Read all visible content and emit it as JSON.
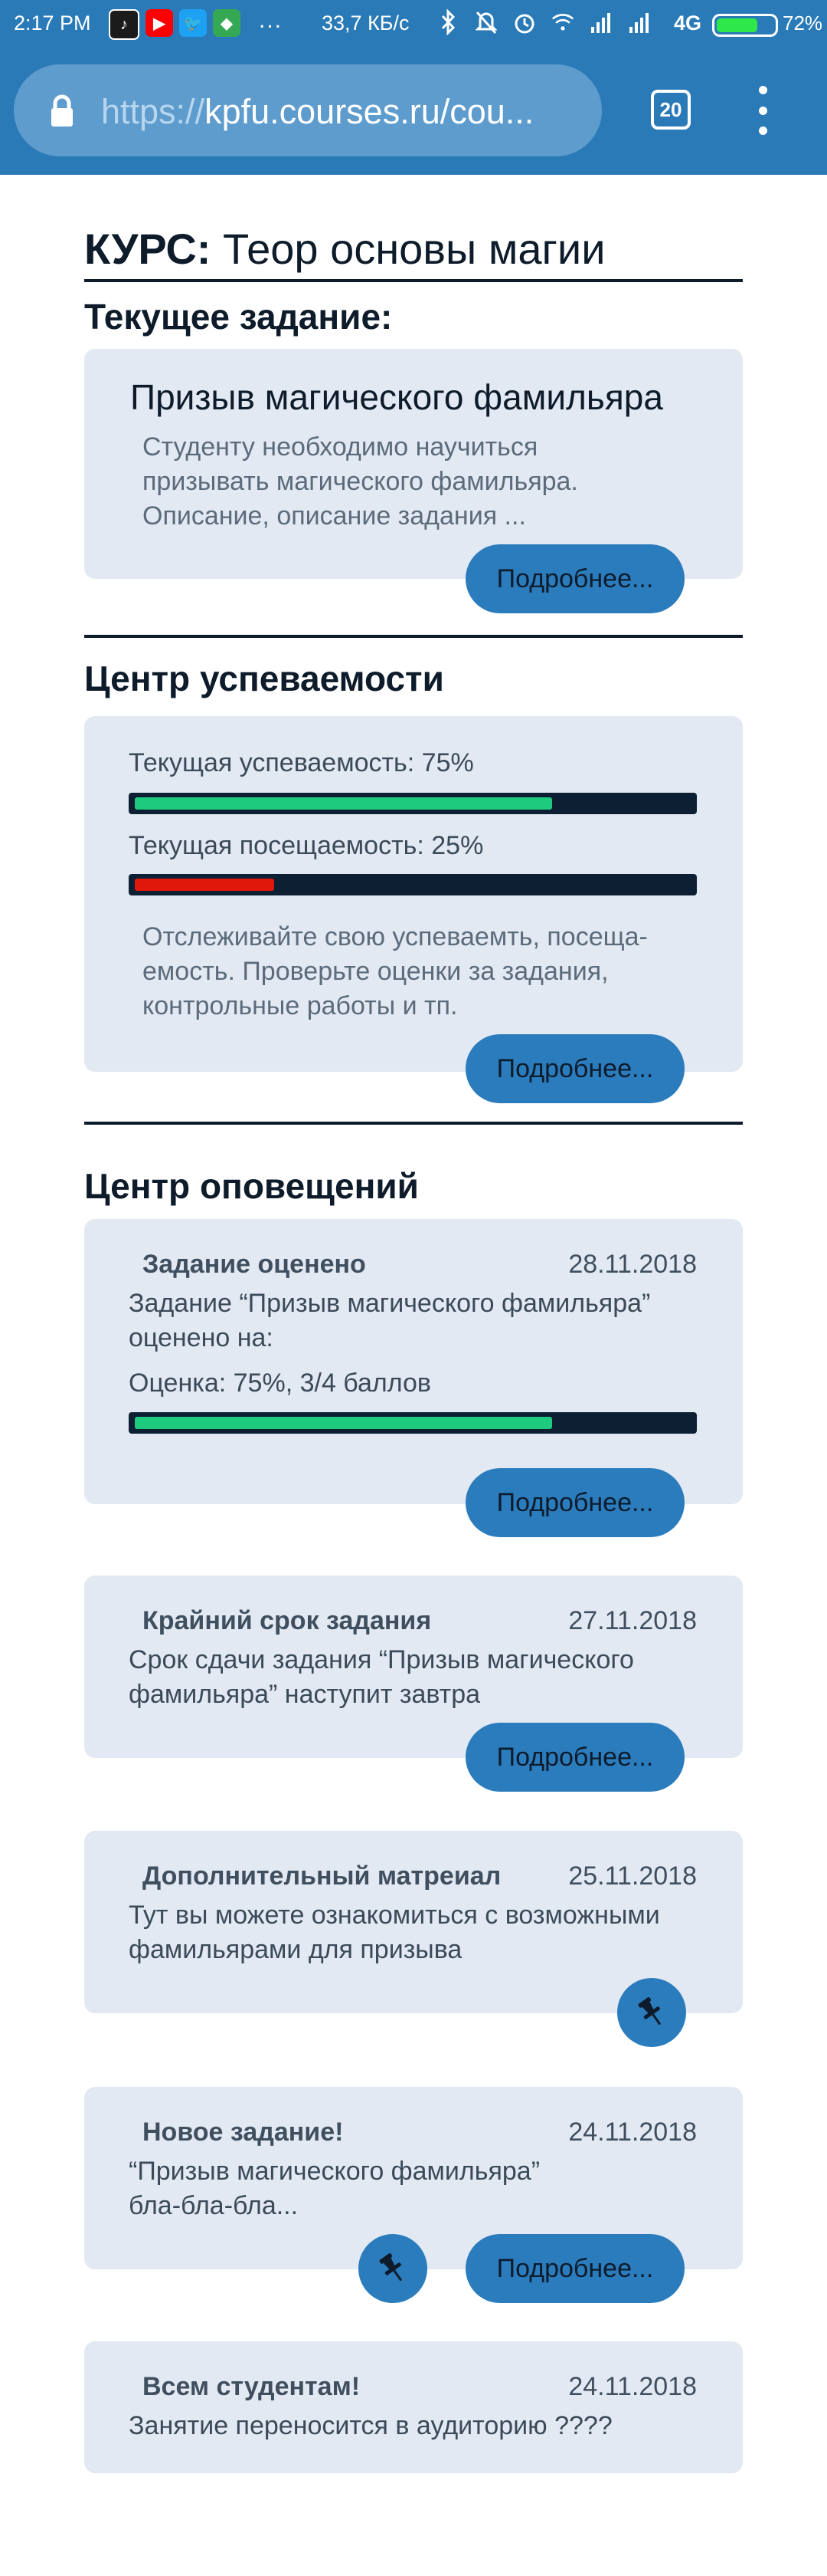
{
  "statusbar": {
    "time": "2:17 PM",
    "dots": "...",
    "speed": "33,7 КБ/с",
    "network": "4G",
    "battery_pct": "72%",
    "battery_level": 0.72
  },
  "browser": {
    "url_proto": "https://",
    "url_rest": "kpfu.courses.ru/cou...",
    "tab_count": "20"
  },
  "course": {
    "prefix": "КУРС:",
    "name": "Теор основы магии"
  },
  "current_task": {
    "heading": "Текущее задание:",
    "title": "Призыв магического фамильяра",
    "description": [
      "Студенту необходимо научиться",
      "призывать магического фамильяра.",
      "Описание, описание задания ..."
    ],
    "more": "Подробнее..."
  },
  "progress": {
    "heading": "Центр успеваемости",
    "grade_label": "Текущая успеваемость: 75%",
    "grade_value": 0.75,
    "attendance_label": "Текущая посещаемость: 25%",
    "attendance_value": 0.25,
    "description": [
      "Отслеживайте свою успеваемть, посеща-",
      "емость. Проверьте оценки за задания,",
      "контрольные работы и тп."
    ],
    "more": "Подробнее..."
  },
  "notifications": {
    "heading": "Центр оповещений",
    "items": [
      {
        "title": "Задание оценено",
        "date": "28.11.2018",
        "lines": [
          "Задание “Призыв магического фамильяра”",
          "оценено на:"
        ],
        "score_label": "Оценка: 75%, 3/4 баллов",
        "score_value": 0.75,
        "more": "Подробнее..."
      },
      {
        "title": "Крайний срок задания",
        "date": "27.11.2018",
        "lines": [
          "Срок сдачи задания “Призыв магического",
          "фамильяра” наступит завтра"
        ],
        "more": "Подробнее..."
      },
      {
        "title": "Дополнительный матреиал",
        "date": "25.11.2018",
        "lines": [
          "Тут вы можете ознакомиться с возможными",
          "фамильярами для призыва"
        ],
        "icon": "pin-icon"
      },
      {
        "title": "Новое задание!",
        "date": "24.11.2018",
        "lines": [
          "“Призыв магического фамильяра”",
          "бла-бла-бла..."
        ],
        "icon": "pin-icon",
        "more": "Подробнее..."
      },
      {
        "title": "Всем студентам!",
        "date": "24.11.2018",
        "lines": [
          "Занятие переносится в аудиторию ????"
        ]
      }
    ]
  },
  "colors": {
    "topbar": "#2a7ab8",
    "card": "#e3e9f2",
    "button": "#2b7cbd",
    "bar_bg": "#0d1f33",
    "bar_green": "#1ecb7e",
    "bar_red": "#e0180c"
  }
}
